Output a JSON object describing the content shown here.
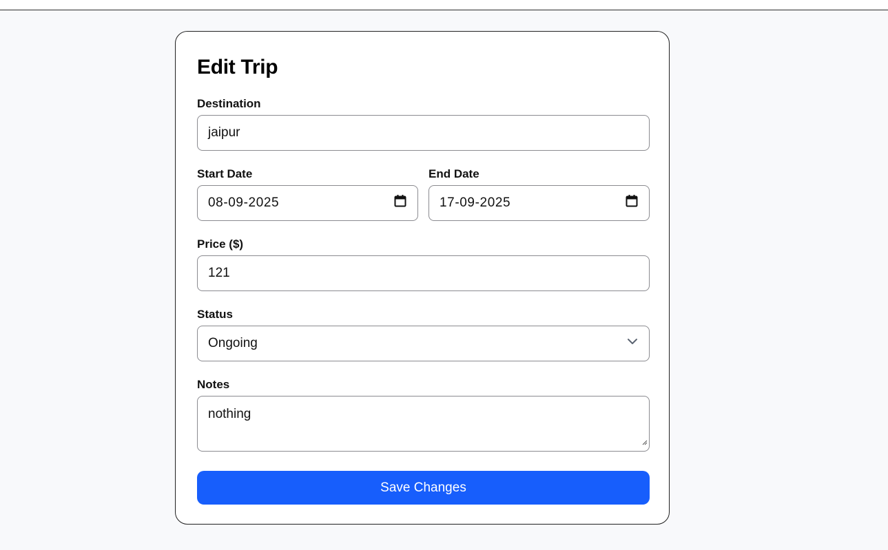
{
  "form": {
    "title": "Edit Trip",
    "destination": {
      "label": "Destination",
      "value": "jaipur"
    },
    "start_date": {
      "label": "Start Date",
      "value": "08-09-2025",
      "icon": "calendar-icon"
    },
    "end_date": {
      "label": "End Date",
      "value": "17-09-2025",
      "icon": "calendar-icon"
    },
    "price": {
      "label": "Price ($)",
      "value": "121"
    },
    "status": {
      "label": "Status",
      "value": "Ongoing",
      "icon": "chevron-down-icon"
    },
    "notes": {
      "label": "Notes",
      "value": "nothing"
    },
    "save_label": "Save Changes"
  },
  "colors": {
    "primary": "#175efc",
    "background": "#f8f9fb",
    "card": "#ffffff",
    "border": "#8a8a8f"
  }
}
